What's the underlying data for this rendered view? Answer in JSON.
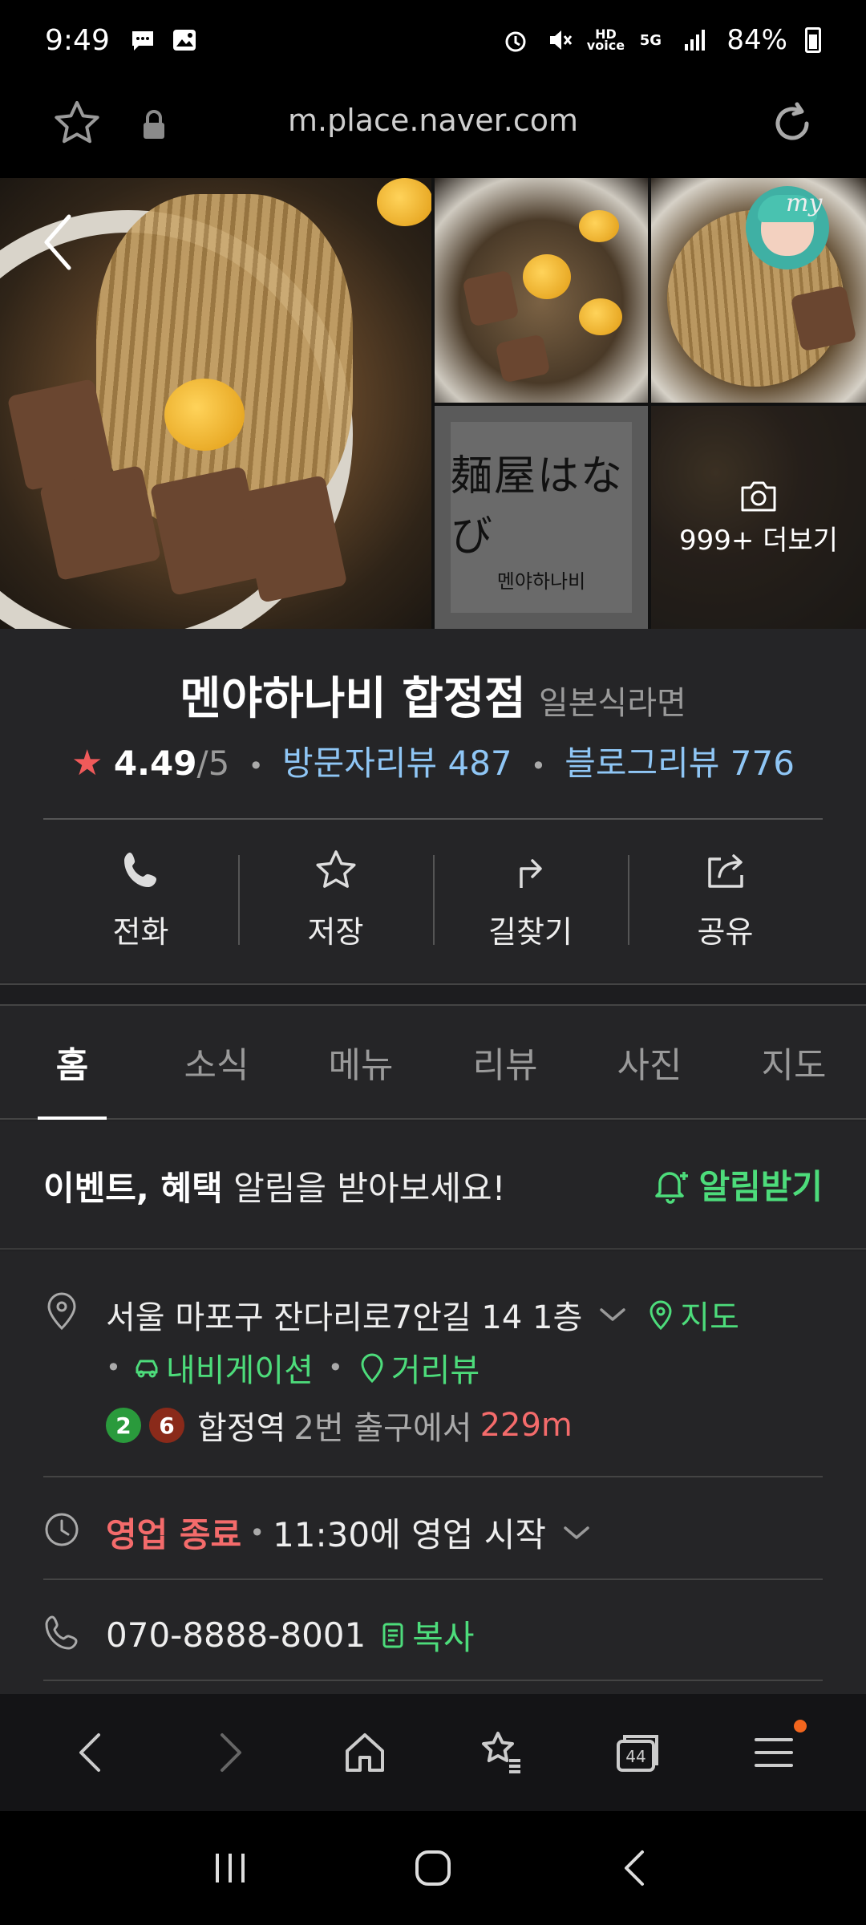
{
  "status": {
    "time": "9:49",
    "battery": "84%",
    "left_icons": [
      "chat-icon",
      "gallery-icon"
    ],
    "right_icons": [
      "alarm-icon",
      "mute-icon",
      "hd-voice-icon",
      "5g-icon",
      "signal-icon",
      "battery-icon"
    ]
  },
  "browser": {
    "url": "m.place.naver.com"
  },
  "photos": {
    "logo_kanji": "麺屋はなび",
    "logo_hangul": "멘야하나비",
    "more_label": "999+ 더보기",
    "my_badge": "my"
  },
  "place": {
    "name": "멘야하나비 합정점",
    "category": "일본식라면",
    "rating": "4.49",
    "rating_max": "/5",
    "visitor_review": "방문자리뷰 487",
    "blog_review": "블로그리뷰 776"
  },
  "actions": [
    {
      "label": "전화",
      "icon": "phone-icon"
    },
    {
      "label": "저장",
      "icon": "star-icon"
    },
    {
      "label": "길찾기",
      "icon": "directions-icon"
    },
    {
      "label": "공유",
      "icon": "share-icon"
    }
  ],
  "tabs": [
    {
      "label": "홈",
      "active": true
    },
    {
      "label": "소식",
      "active": false
    },
    {
      "label": "메뉴",
      "active": false
    },
    {
      "label": "리뷰",
      "active": false
    },
    {
      "label": "사진",
      "active": false
    },
    {
      "label": "지도",
      "active": false
    }
  ],
  "notice": {
    "bold": "이벤트, 혜택",
    "text": " 알림을 받아보세요!",
    "subscribe": "알림받기"
  },
  "info": {
    "address": "서울 마포구 잔다리로7안길 14 1층",
    "map_link": "지도",
    "navigation": "내비게이션",
    "streetview": "거리뷰",
    "subway_lines": [
      {
        "number": "2",
        "color": "#2a9a3c"
      },
      {
        "number": "6",
        "color": "#8a2a1a"
      }
    ],
    "station": "합정역",
    "exit_text": "2번 출구에서",
    "distance": "229m",
    "status_closed": "영업 종료",
    "hours_next": "11:30에 영업 시작",
    "phone": "070-8888-8001",
    "copy": "복사"
  },
  "colors": {
    "accent_green": "#4ddc7b",
    "link_blue": "#8fc6f5",
    "alert_red": "#f46b6b",
    "star_red": "#f05a5a",
    "notif_orange": "#f2661e"
  },
  "bottom_nav": {
    "tabs_count": "44"
  }
}
